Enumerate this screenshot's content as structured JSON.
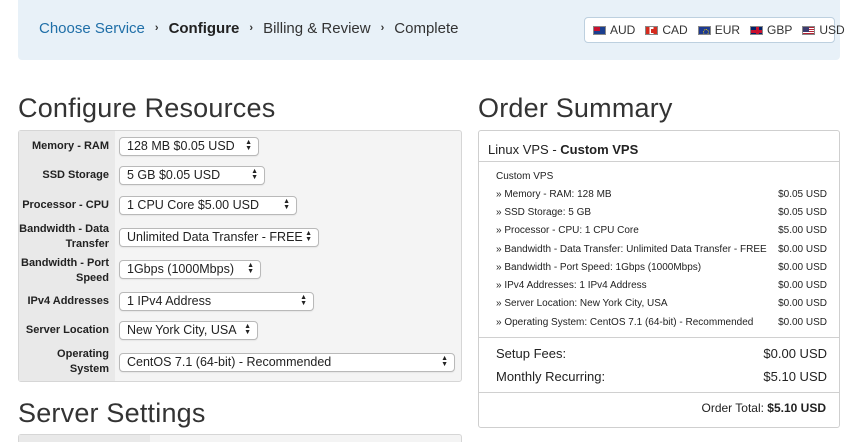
{
  "breadcrumb": {
    "steps": [
      "Choose Service",
      "Configure",
      "Billing & Review",
      "Complete"
    ],
    "separator": "›"
  },
  "currencies": [
    {
      "code": "AUD",
      "flag": "flag-au-icon"
    },
    {
      "code": "CAD",
      "flag": "flag-ca-icon"
    },
    {
      "code": "EUR",
      "flag": "flag-eu-icon"
    },
    {
      "code": "GBP",
      "flag": "flag-gb-icon"
    },
    {
      "code": "USD",
      "flag": "flag-us-icon"
    }
  ],
  "configure": {
    "heading": "Configure Resources",
    "options": [
      {
        "label": "Memory - RAM",
        "value": "128 MB $0.05 USD"
      },
      {
        "label": "SSD Storage",
        "value": "5 GB $0.05 USD"
      },
      {
        "label": "Processor - CPU",
        "value": "1 CPU Core $5.00 USD"
      },
      {
        "label": "Bandwidth - Data Transfer",
        "value": "Unlimited Data Transfer - FREE"
      },
      {
        "label": "Bandwidth - Port Speed",
        "value": "1Gbps (1000Mbps)"
      },
      {
        "label": "IPv4 Addresses",
        "value": "1 IPv4 Address"
      },
      {
        "label": "Server Location",
        "value": "New York City, USA"
      },
      {
        "label": "Operating System",
        "value": "CentOS 7.1 (64-bit) - Recommended"
      }
    ]
  },
  "server_settings": {
    "heading": "Server Settings"
  },
  "summary": {
    "heading": "Order Summary",
    "product_group": "Linux VPS - ",
    "product_name": "Custom VPS",
    "subtitle": "Custom VPS",
    "lines": [
      {
        "desc": "» Memory - RAM: 128 MB",
        "price": "$0.05 USD"
      },
      {
        "desc": "» SSD Storage: 5 GB",
        "price": "$0.05 USD"
      },
      {
        "desc": "» Processor - CPU: 1 CPU Core",
        "price": "$5.00 USD"
      },
      {
        "desc": "» Bandwidth - Data Transfer: Unlimited Data Transfer - FREE",
        "price": "$0.00 USD"
      },
      {
        "desc": "» Bandwidth - Port Speed: 1Gbps (1000Mbps)",
        "price": "$0.00 USD"
      },
      {
        "desc": "» IPv4 Addresses: 1 IPv4 Address",
        "price": "$0.00 USD"
      },
      {
        "desc": "» Server Location: New York City, USA",
        "price": "$0.00 USD"
      },
      {
        "desc": "» Operating System: CentOS 7.1 (64-bit) - Recommended",
        "price": "$0.00 USD"
      }
    ],
    "setup_label": "Setup Fees:",
    "setup_value": "$0.00 USD",
    "monthly_label": "Monthly Recurring:",
    "monthly_value": "$5.10 USD",
    "total_label": "Order Total: ",
    "total_value": "$5.10 USD"
  }
}
